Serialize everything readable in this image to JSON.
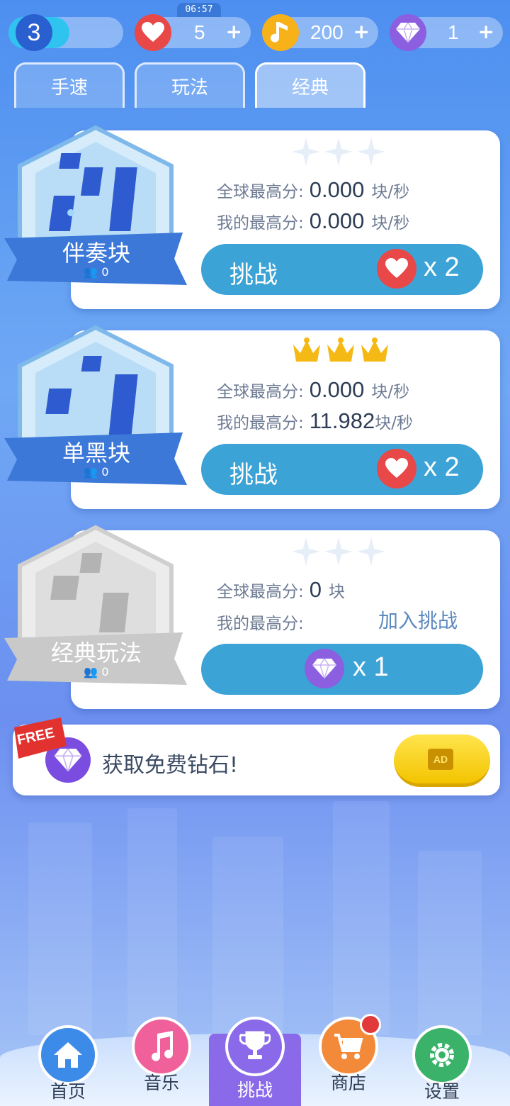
{
  "status": {
    "time": "06:57"
  },
  "topbar": {
    "level": "3",
    "hearts": "5",
    "notes": "200",
    "diamonds": "1",
    "plus": "+"
  },
  "tabs": [
    {
      "label": "手速"
    },
    {
      "label": "玩法"
    },
    {
      "label": "经典",
      "active": true
    }
  ],
  "labels": {
    "global_best": "全球最高分:",
    "my_best": "我的最高分:"
  },
  "modes": [
    {
      "name": "伴奏块",
      "players": "0",
      "stars": "empty",
      "global_score": "0.000",
      "global_unit": "块/秒",
      "my_score": "0.000",
      "my_unit": "块/秒",
      "button_label": "挑战",
      "cost_icon": "heart-icon",
      "cost": "x 2"
    },
    {
      "name": "单黑块",
      "players": "0",
      "stars": "crowns",
      "global_score": "0.000",
      "global_unit": "块/秒",
      "my_score": "11.982",
      "my_unit": "块/秒",
      "button_label": "挑战",
      "cost_icon": "heart-icon",
      "cost": "x 2"
    },
    {
      "name": "经典玩法",
      "players": "0",
      "stars": "empty",
      "global_score": "0",
      "global_unit": "块",
      "join_label": "加入挑战",
      "cost_icon": "diamond-icon",
      "cost": "x 1"
    }
  ],
  "free_diamonds": {
    "tag": "FREE",
    "text": "获取免费钻石!",
    "ad_label": "AD"
  },
  "nav": [
    {
      "label": "首页",
      "icon": "home-icon",
      "color": "#3d8be8"
    },
    {
      "label": "音乐",
      "icon": "music-note-icon",
      "color": "#f0609a"
    },
    {
      "label": "挑战",
      "icon": "trophy-icon",
      "color": "#8a6ae8",
      "active": true
    },
    {
      "label": "商店",
      "icon": "cart-icon",
      "color": "#f38a3a"
    },
    {
      "label": "设置",
      "icon": "gear-icon",
      "color": "#3bb26a"
    }
  ],
  "colors": {
    "accent_button": "#3ba3d6",
    "heart": "#e84848",
    "coin": "#f7b21a",
    "diamond": "#8b5fe0",
    "crown": "#f5b915"
  }
}
